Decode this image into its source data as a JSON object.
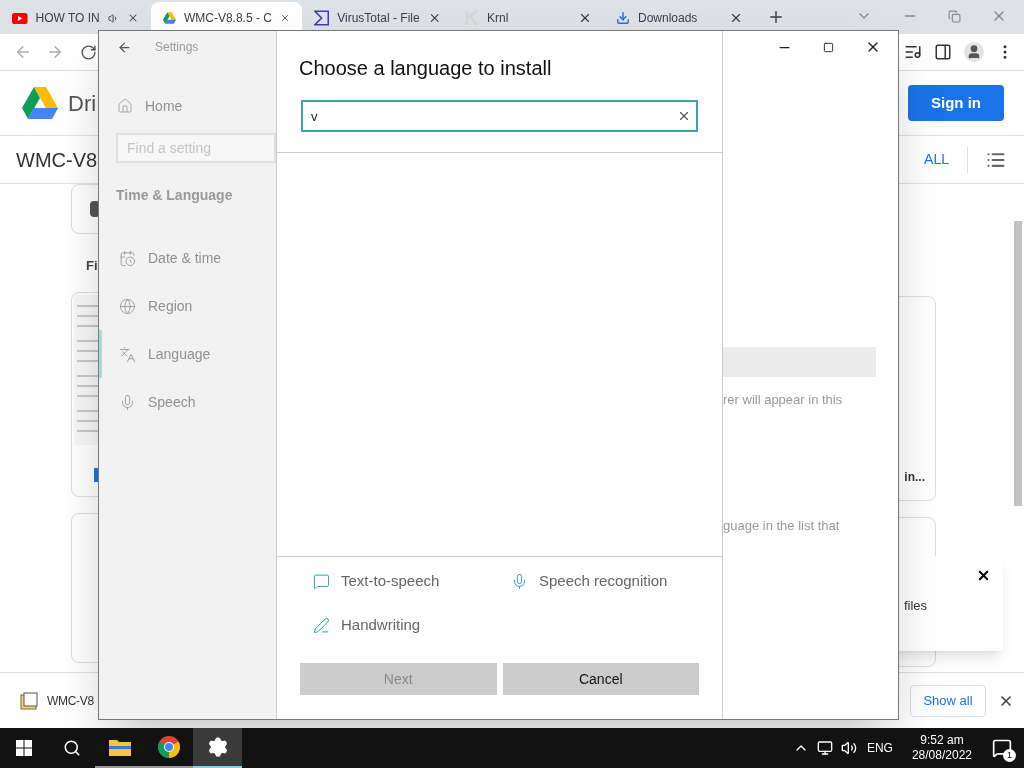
{
  "browser": {
    "tabs": [
      {
        "title": "HOW TO IN",
        "kind": "youtube",
        "audio": true,
        "selected": false
      },
      {
        "title": "WMC-V8.8.5 - C",
        "kind": "drive",
        "audio": false,
        "selected": true
      },
      {
        "title": "VirusTotal - File",
        "kind": "virustotal",
        "audio": false,
        "selected": false
      },
      {
        "title": "Krnl",
        "kind": "krnl",
        "audio": false,
        "selected": false
      },
      {
        "title": "Downloads",
        "kind": "download",
        "audio": false,
        "selected": false
      }
    ]
  },
  "drive": {
    "logo_text": "Dri",
    "sign_in": "Sign in",
    "file_title": "WMC-V8",
    "download_all": "ALL",
    "section_label": "Fi",
    "card_caption": "in...",
    "toast_text": "files"
  },
  "download_bar": {
    "file": "WMC-V8",
    "show_all": "Show all"
  },
  "settings": {
    "title": "Settings",
    "home": "Home",
    "search_placeholder": "Find a setting",
    "section": "Time & Language",
    "items": [
      {
        "label": "Date & time",
        "kind": "calendar",
        "selected": false
      },
      {
        "label": "Region",
        "kind": "globe",
        "selected": false
      },
      {
        "label": "Language",
        "kind": "language",
        "selected": true
      },
      {
        "label": "Speech",
        "kind": "mic",
        "selected": false
      }
    ],
    "background_texts": [
      "rer will appear in this",
      "guage in the list that"
    ]
  },
  "dialog": {
    "title": "Choose a language to install",
    "search_value": "v",
    "features": [
      {
        "label": "Text-to-speech",
        "kind": "tts"
      },
      {
        "label": "Speech recognition",
        "kind": "mic"
      },
      {
        "label": "Handwriting",
        "kind": "pen"
      }
    ],
    "buttons": [
      {
        "label": "Next",
        "disabled": true
      },
      {
        "label": "Cancel",
        "disabled": false
      }
    ]
  },
  "taskbar": {
    "apps": [
      {
        "kind": "explorer",
        "open": true,
        "selected": false
      },
      {
        "kind": "chrome",
        "open": true,
        "selected": false
      },
      {
        "kind": "settings",
        "open": true,
        "selected": true
      }
    ],
    "language": "ENG",
    "time": "9:52 am",
    "date": "28/08/2022",
    "notifications": "1"
  }
}
